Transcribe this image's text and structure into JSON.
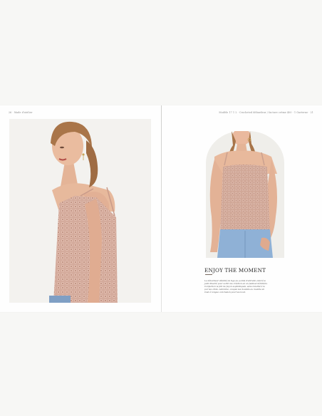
{
  "spread": {
    "left_page": {
      "running_head": "26   ·   Made d'atelier"
    },
    "right_page": {
      "running_head": "Modèle 17 1 2   ·   Crocheted débardeur / facture crème 400   ·   1 Garterne   ·   21",
      "title": "ENJOY THE MOMENT",
      "body_lines": [
        "Le débardeur détaillé de tige au points d'entrelia enloré le",
        "joint illustré pour sortir les création en un festival déridière.",
        "Confection le fait de façon sophistiquée, sans tonalité à la",
        "pur les côtés. Adorable, coupée les doublés au modèle en",
        "Cest à longue conclusion pour les bout."
      ]
    }
  },
  "colors": {
    "page_bg": "#f7f7f5",
    "paper": "#fefefe",
    "knit_pink": "#d2a99a",
    "knit_shadow": "#b98978",
    "skin": "#e7b79b",
    "hair": "#a8754a",
    "denim": "#8fb1d6"
  },
  "images": [
    {
      "icon": "model-photo-knit-top-side-view"
    },
    {
      "icon": "model-photo-knit-top-front-view"
    }
  ]
}
